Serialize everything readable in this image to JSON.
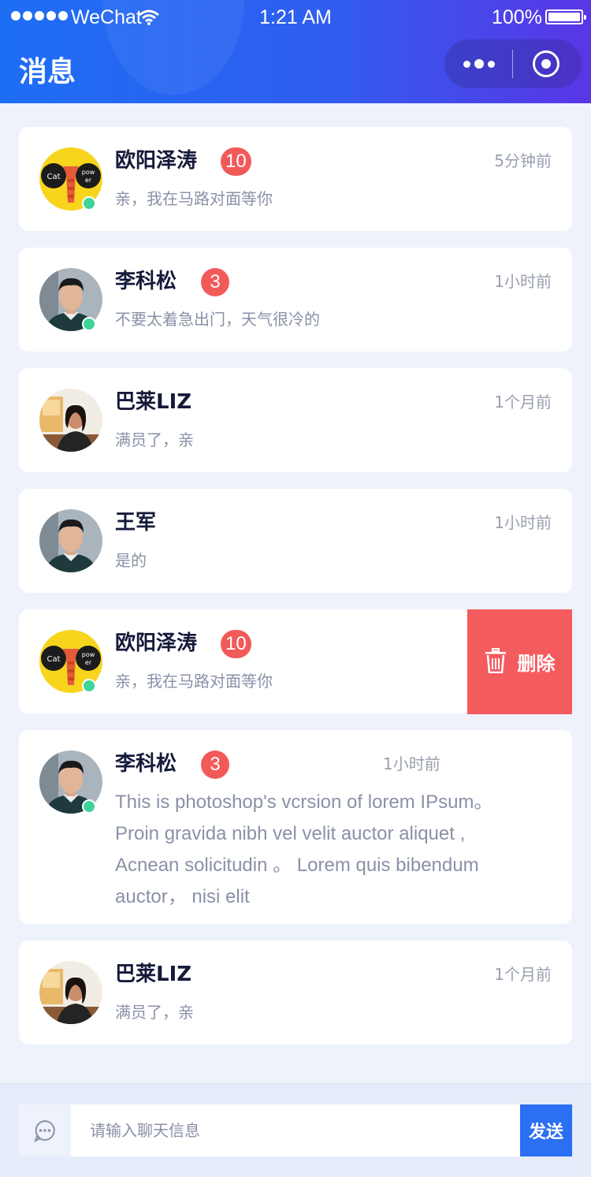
{
  "status_bar": {
    "carrier": "WeChat",
    "time": "1:21 AM",
    "battery": "100%"
  },
  "header": {
    "title": "消息",
    "icons": [
      "more-icon",
      "target-icon"
    ]
  },
  "colors": {
    "header_gradient_start": "#1e6ef4",
    "header_gradient_end": "#5a35e6",
    "badge": "#f25a5a",
    "online": "#3ed49a",
    "delete": "#f45b5f",
    "send": "#2b6ff2"
  },
  "conversations": [
    {
      "name": "欧阳泽涛",
      "badge": "10",
      "time": "5分钟前",
      "preview": "亲，我在马路对面等你",
      "online": true,
      "avatar": "cat-power-avatar"
    },
    {
      "name": "李科松",
      "badge": "3",
      "time": "1小时前",
      "preview": "不要太着急出门，天气很冷的",
      "online": true,
      "avatar": "man-avatar"
    },
    {
      "name": "巴莱LIZ",
      "badge": "",
      "time": "1个月前",
      "preview": "满员了，亲",
      "online": false,
      "avatar": "woman-avatar"
    },
    {
      "name": "王军",
      "badge": "",
      "time": "1小时前",
      "preview": "是的",
      "online": false,
      "avatar": "man-avatar"
    },
    {
      "name": "欧阳泽涛",
      "badge": "10",
      "time": "",
      "preview": "亲，我在马路对面等你",
      "online": true,
      "avatar": "cat-power-avatar",
      "swiped": true,
      "delete_label": "删除"
    },
    {
      "name": "李科松",
      "badge": "3",
      "time": "1小时前",
      "preview": "This is photoshop's vcrsion of lorem IPsum。Proin gravida nibh vel velit auctor aliquet , Acnean solicitudin 。 Lorem quis bibendum  auctor， nisi elit",
      "online": true,
      "avatar": "man-avatar"
    },
    {
      "name": "巴莱LIZ",
      "badge": "",
      "time": "1个月前",
      "preview": "满员了，亲",
      "online": false,
      "avatar": "woman-avatar"
    }
  ],
  "input_bar": {
    "placeholder": "请输入聊天信息",
    "send_label": "发送"
  }
}
